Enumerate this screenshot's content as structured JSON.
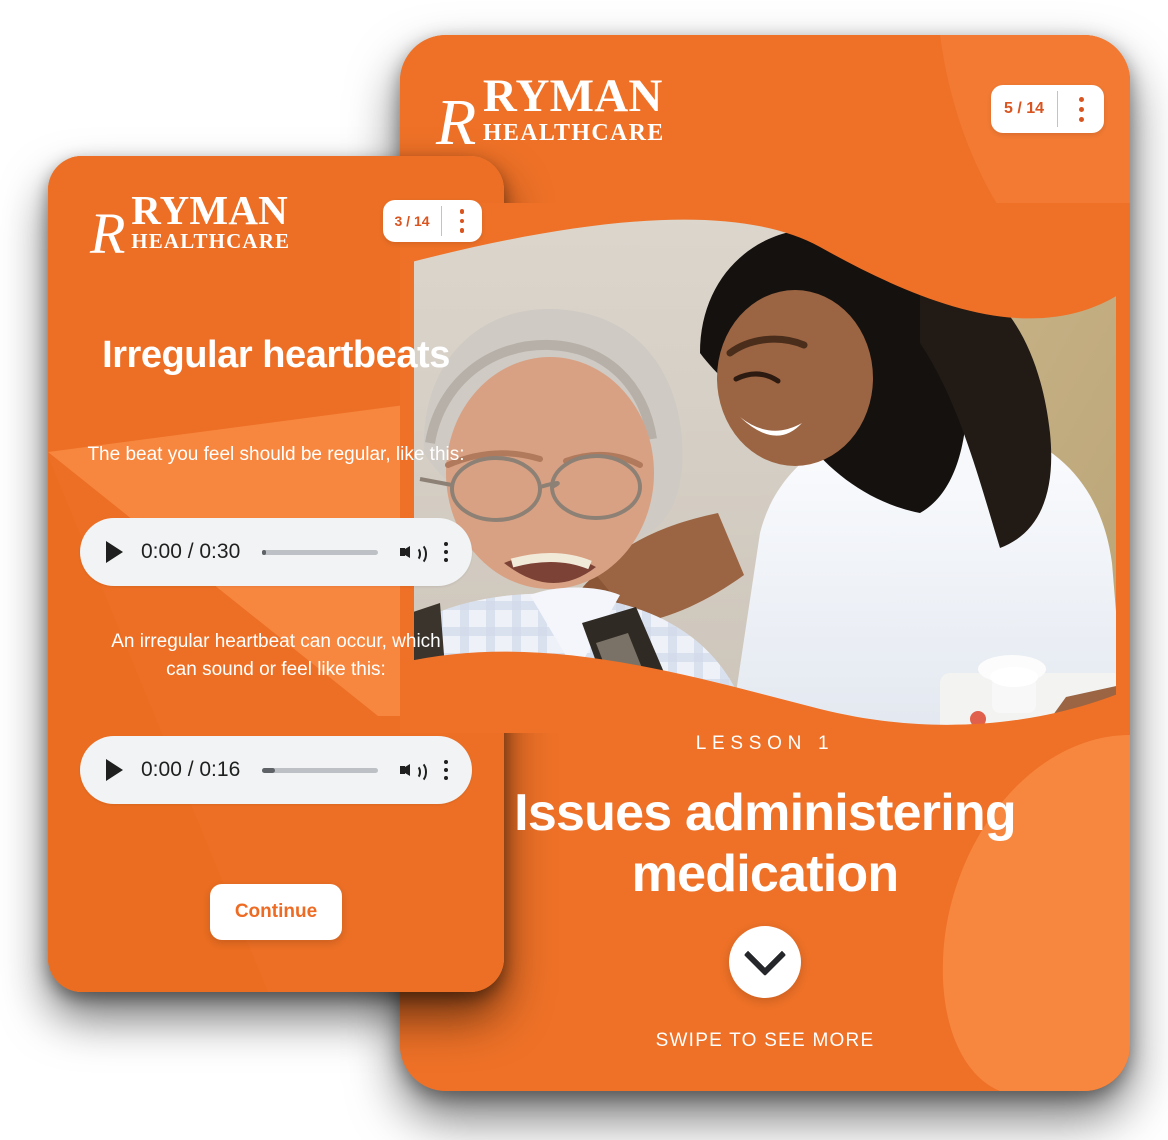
{
  "theme": {
    "orange_dark": "#ee7127",
    "orange_light": "#f7873f",
    "orange_deep": "#e8671f",
    "accent_text": "#d9541f",
    "button_text": "#ee6b23",
    "white": "#ffffff"
  },
  "back_phone": {
    "name": "lesson-intro-screen",
    "logo": {
      "mark": "R",
      "line1": "RYMAN",
      "line2": "HEALTHCARE"
    },
    "counter": "5 / 14",
    "menu_icon": "overflow-menu-icon",
    "photo_alt": "caregiver-with-elderly-resident-photo",
    "kicker": "LESSON 1",
    "title": "Issues administering medication",
    "chevron_icon": "chevron-down-icon",
    "swipe_hint": "SWIPE TO SEE MORE"
  },
  "front_phone": {
    "name": "irregular-heartbeats-screen",
    "logo": {
      "mark": "R",
      "line1": "RYMAN",
      "line2": "HEALTHCARE"
    },
    "counter": "3 / 14",
    "menu_icon": "overflow-menu-icon",
    "title": "Irregular heartbeats",
    "caption_1": "The beat you feel should be regular, like this:",
    "caption_2": "An irregular heartbeat can occur, which can sound or feel like this:",
    "players": [
      {
        "time": "0:00 / 0:30",
        "play_icon": "play-icon",
        "volume_icon": "volume-icon",
        "menu_icon": "overflow-menu-icon",
        "progress_percent": 3
      },
      {
        "time": "0:00 / 0:16",
        "play_icon": "play-icon",
        "volume_icon": "volume-icon",
        "menu_icon": "overflow-menu-icon",
        "progress_percent": 11
      }
    ],
    "continue_label": "Continue"
  }
}
